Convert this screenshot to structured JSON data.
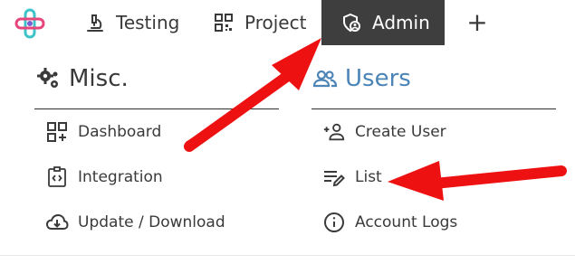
{
  "nav": {
    "testing_label": "Testing",
    "project_label": "Project",
    "admin_label": "Admin",
    "add_label": "+"
  },
  "misc": {
    "heading": "Misc.",
    "items": [
      {
        "label": "Dashboard",
        "icon": "dashboard-icon"
      },
      {
        "label": "Integration",
        "icon": "integration-icon"
      },
      {
        "label": "Update / Download",
        "icon": "cloud-download-icon"
      }
    ]
  },
  "users": {
    "heading": "Users",
    "items": [
      {
        "label": "Create User",
        "icon": "add-user-icon"
      },
      {
        "label": "List",
        "icon": "list-edit-icon"
      },
      {
        "label": "Account Logs",
        "icon": "info-icon"
      }
    ]
  },
  "colors": {
    "admin_tab_bg": "#3e3e3e",
    "users_accent": "#4b85b8",
    "annotation_arrow": "#ee1111"
  }
}
